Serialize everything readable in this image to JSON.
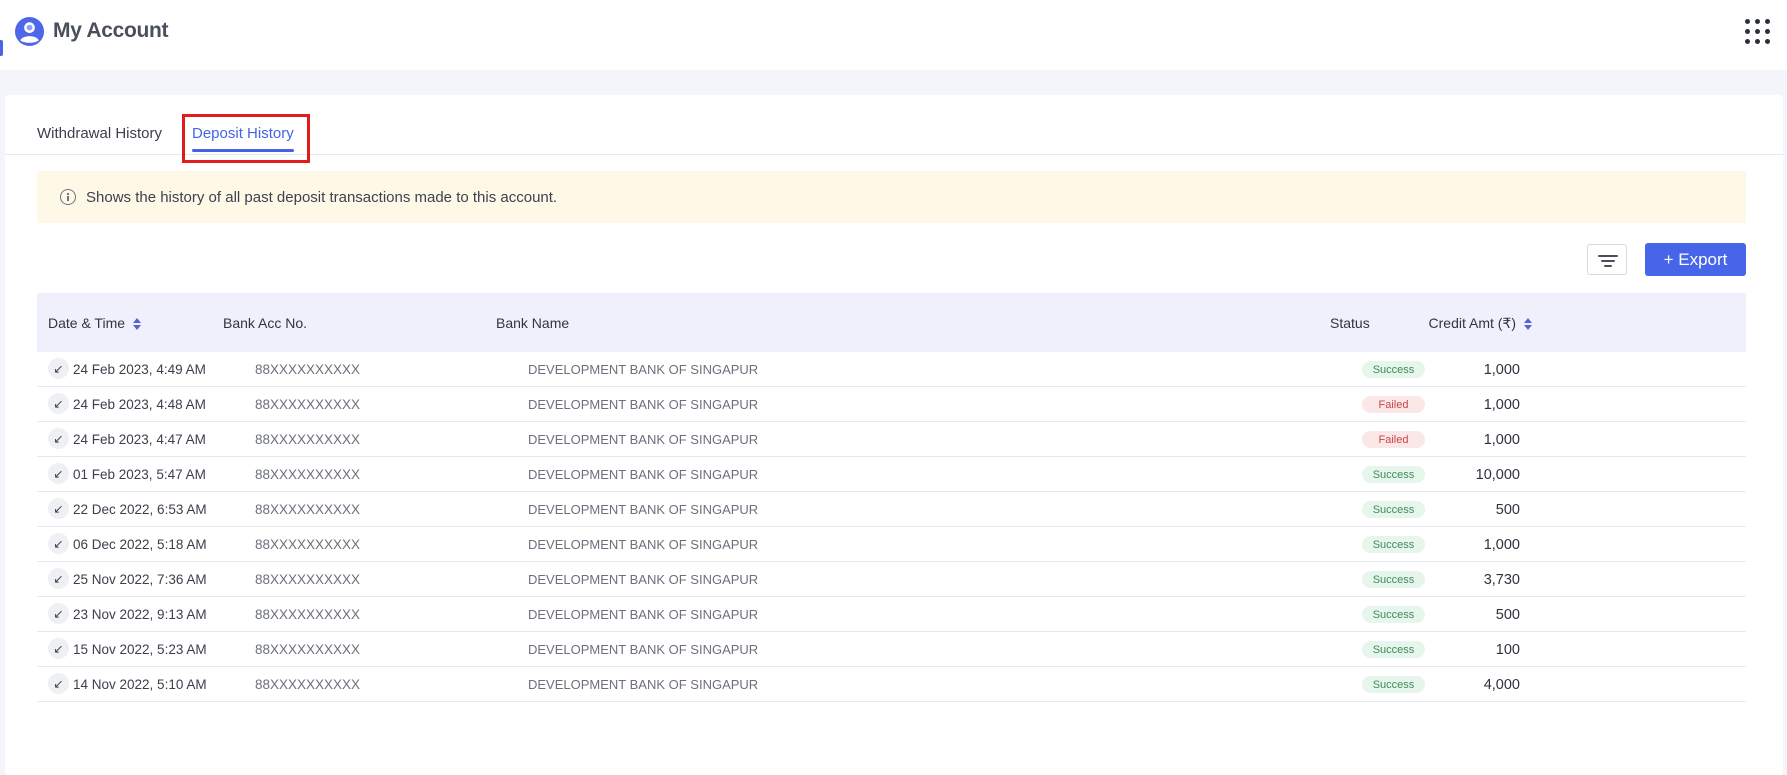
{
  "header": {
    "title": "My Account",
    "logo_icon": "user-avatar-icon",
    "apps_icon": "grid-menu-icon"
  },
  "tabs": [
    {
      "label": "Withdrawal History",
      "active": false
    },
    {
      "label": "Deposit History",
      "active": true
    }
  ],
  "info": {
    "icon": "info-icon",
    "text": "Shows the history of all past deposit transactions made to this account."
  },
  "toolbar": {
    "filter_icon": "filter-icon",
    "export_label": "+ Export"
  },
  "table": {
    "columns": [
      "Date & Time",
      "Bank Acc No.",
      "Bank Name",
      "Credit Amt (₹)",
      "Status"
    ],
    "rows": [
      {
        "date": "24 Feb 2023, 4:49 AM",
        "acc": "88XXXXXXXXXX",
        "bank": "DEVELOPMENT BANK OF SINGAPUR",
        "amount": "1,000",
        "status": "Success"
      },
      {
        "date": "24 Feb 2023, 4:48 AM",
        "acc": "88XXXXXXXXXX",
        "bank": "DEVELOPMENT BANK OF SINGAPUR",
        "amount": "1,000",
        "status": "Failed"
      },
      {
        "date": "24 Feb 2023, 4:47 AM",
        "acc": "88XXXXXXXXXX",
        "bank": "DEVELOPMENT BANK OF SINGAPUR",
        "amount": "1,000",
        "status": "Failed"
      },
      {
        "date": "01 Feb 2023, 5:47 AM",
        "acc": "88XXXXXXXXXX",
        "bank": "DEVELOPMENT BANK OF SINGAPUR",
        "amount": "10,000",
        "status": "Success"
      },
      {
        "date": "22 Dec 2022, 6:53 AM",
        "acc": "88XXXXXXXXXX",
        "bank": "DEVELOPMENT BANK OF SINGAPUR",
        "amount": "500",
        "status": "Success"
      },
      {
        "date": "06 Dec 2022, 5:18 AM",
        "acc": "88XXXXXXXXXX",
        "bank": "DEVELOPMENT BANK OF SINGAPUR",
        "amount": "1,000",
        "status": "Success"
      },
      {
        "date": "25 Nov 2022, 7:36 AM",
        "acc": "88XXXXXXXXXX",
        "bank": "DEVELOPMENT BANK OF SINGAPUR",
        "amount": "3,730",
        "status": "Success"
      },
      {
        "date": "23 Nov 2022, 9:13 AM",
        "acc": "88XXXXXXXXXX",
        "bank": "DEVELOPMENT BANK OF SINGAPUR",
        "amount": "500",
        "status": "Success"
      },
      {
        "date": "15 Nov 2022, 5:23 AM",
        "acc": "88XXXXXXXXXX",
        "bank": "DEVELOPMENT BANK OF SINGAPUR",
        "amount": "100",
        "status": "Success"
      },
      {
        "date": "14 Nov 2022, 5:10 AM",
        "acc": "88XXXXXXXXXX",
        "bank": "DEVELOPMENT BANK OF SINGAPUR",
        "amount": "4,000",
        "status": "Success"
      }
    ]
  },
  "colors": {
    "accent": "#4765e9",
    "highlight": "#e21b1b",
    "success": "#3f8b59",
    "failed": "#c94545"
  }
}
